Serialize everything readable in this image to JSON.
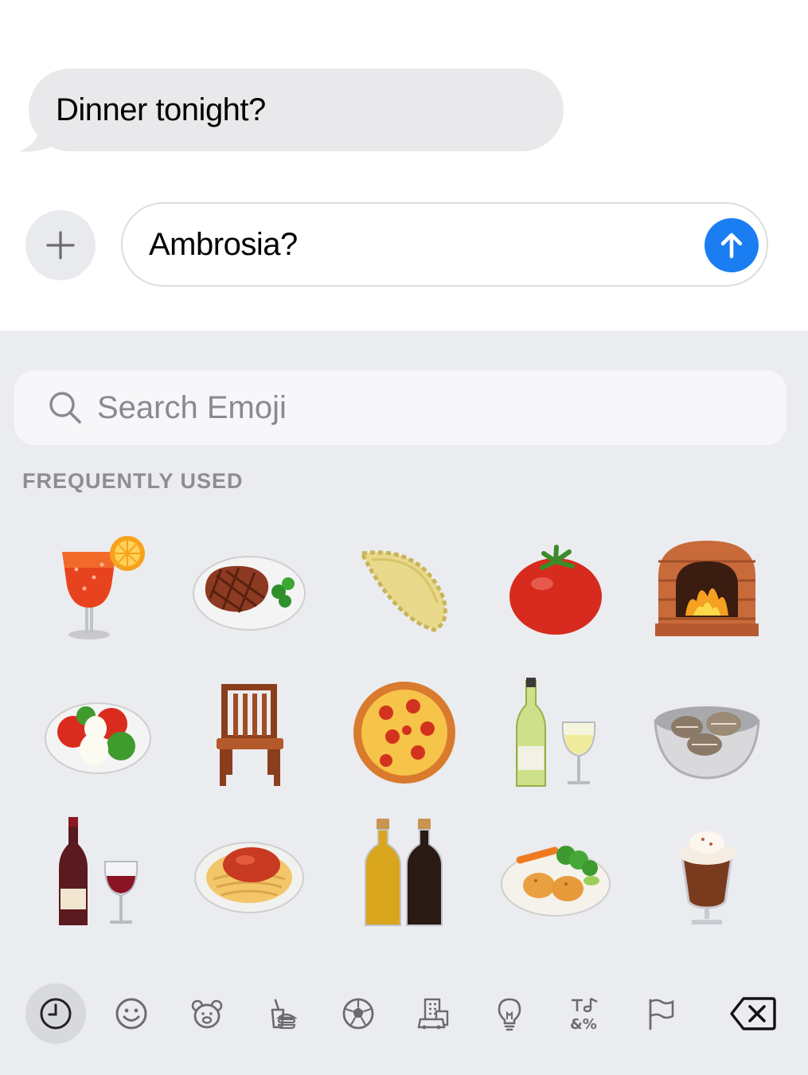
{
  "conversation": {
    "incoming_message": "Dinner tonight?",
    "compose_text": "Ambrosia?"
  },
  "emoji_keyboard": {
    "search_placeholder": "Search Emoji",
    "section_title": "FREQUENTLY USED",
    "emojis": [
      "tropical-drink",
      "steak",
      "empanada",
      "tomato",
      "pizza-oven",
      "caprese-salad",
      "wooden-chair",
      "pizza",
      "white-wine",
      "clams",
      "red-wine",
      "spaghetti",
      "oil-and-vinegar",
      "scallops-plate",
      "hot-chocolate"
    ],
    "category_tabs": [
      "recent-clock-icon",
      "smiley-icon",
      "bear-icon",
      "food-icon",
      "soccer-ball-icon",
      "building-icon",
      "lightbulb-icon",
      "symbols-icon",
      "flag-icon"
    ],
    "active_tab": "recent"
  },
  "colors": {
    "send_button": "#1a7ef2",
    "bubble_gray": "#e9e9eb",
    "keyboard_bg": "#ebecef"
  }
}
